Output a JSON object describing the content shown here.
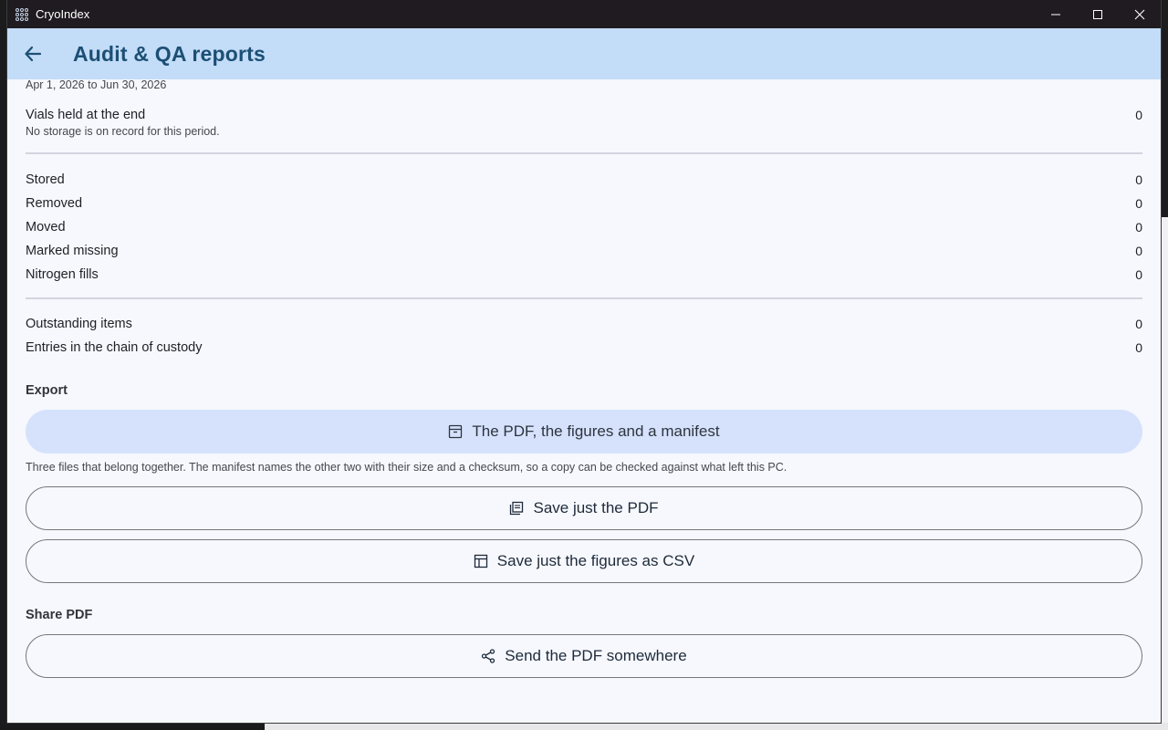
{
  "window": {
    "title": "CryoIndex",
    "controls": {
      "minimize": "minimize-icon",
      "maximize": "maximize-icon",
      "close": "close-icon"
    }
  },
  "appbar": {
    "back_icon": "arrow-left-icon",
    "title": "Audit & QA reports"
  },
  "report": {
    "range": "Apr 1, 2026 to Jun 30, 2026",
    "vials_held": {
      "label": "Vials held at the end",
      "value": "0"
    },
    "storage_note": "No storage is on record for this period.",
    "activity": [
      {
        "label": "Stored",
        "value": "0"
      },
      {
        "label": "Removed",
        "value": "0"
      },
      {
        "label": "Moved",
        "value": "0"
      },
      {
        "label": "Marked missing",
        "value": "0"
      },
      {
        "label": "Nitrogen fills",
        "value": "0"
      }
    ],
    "outstanding": {
      "label": "Outstanding items",
      "value": "0"
    },
    "custody": {
      "label": "Entries in the chain of custody",
      "value": "0"
    }
  },
  "export": {
    "heading": "Export",
    "bundle_label": "The PDF, the figures and a manifest",
    "bundle_icon": "archive-icon",
    "bundle_help": "Three files that belong together. The manifest names the other two with their size and a checksum, so a copy can be checked against what left this PC.",
    "pdf_label": "Save just the PDF",
    "pdf_icon": "pdf-file-icon",
    "csv_label": "Save just the figures as CSV",
    "csv_icon": "table-icon"
  },
  "share": {
    "heading": "Share PDF",
    "send_label": "Send the PDF somewhere",
    "send_icon": "share-icon"
  },
  "colors": {
    "appbar": "#c3dcf7",
    "title": "#1c4f74",
    "surface": "#f6f8fd",
    "filled_button": "#d6e2fb",
    "titlebar": "#1f1b20"
  }
}
